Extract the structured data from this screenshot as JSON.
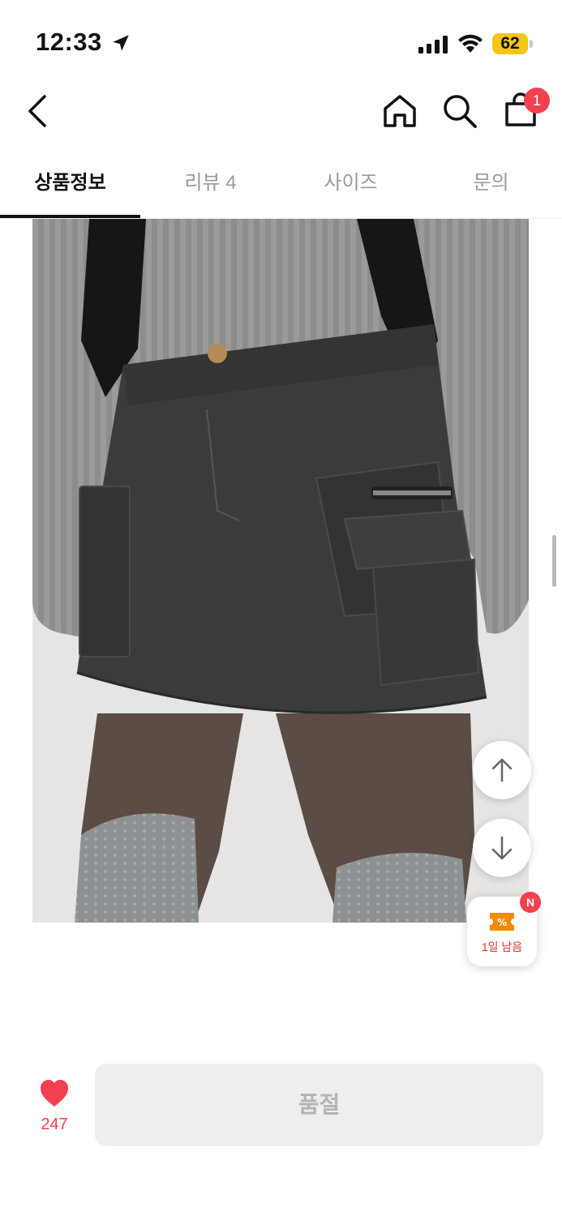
{
  "status_bar": {
    "time": "12:33",
    "battery": "62"
  },
  "nav": {
    "cart_count": "1"
  },
  "tabs": [
    {
      "label": "상품정보",
      "active": true
    },
    {
      "label": "리뷰 4",
      "active": false
    },
    {
      "label": "사이즈",
      "active": false
    },
    {
      "label": "문의",
      "active": false
    }
  ],
  "coupon": {
    "badge": "N",
    "label": "1일 남음"
  },
  "bottom_bar": {
    "like_count": "247",
    "button_label": "품절"
  },
  "colors": {
    "accent": "#f2404f",
    "battery": "#f5c518",
    "coupon": "#f08c00"
  }
}
